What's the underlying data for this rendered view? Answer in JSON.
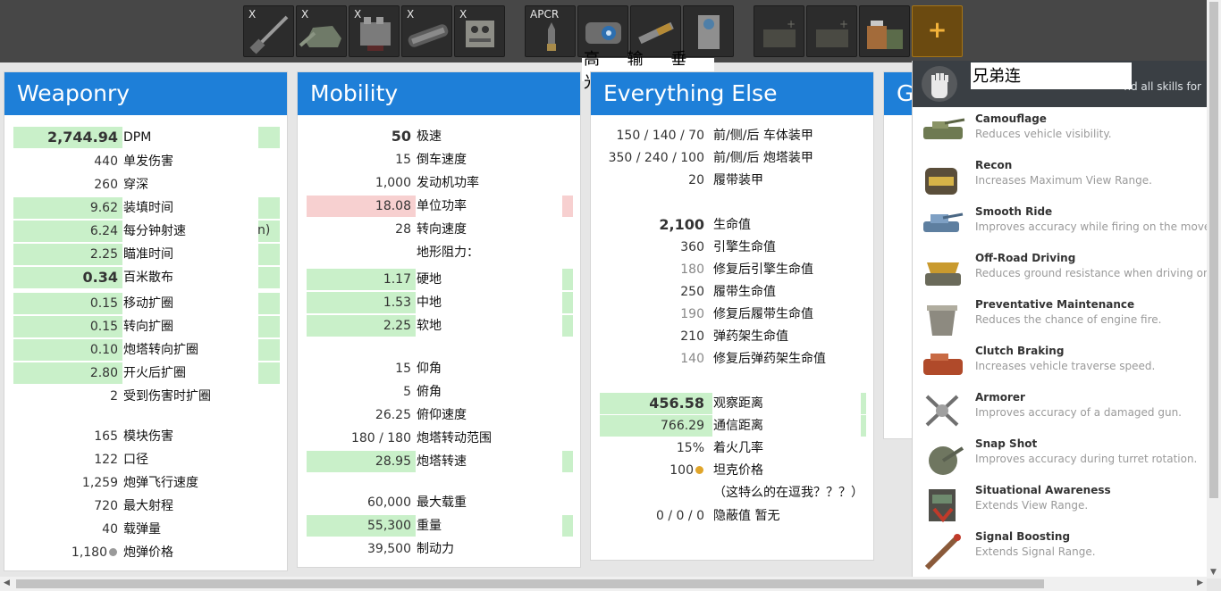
{
  "toolbar": {
    "slots": [
      {
        "tag": "X",
        "icon": "gun-icon"
      },
      {
        "tag": "X",
        "icon": "turret-icon"
      },
      {
        "tag": "X",
        "icon": "engine-icon"
      },
      {
        "tag": "X",
        "icon": "tracks-icon"
      },
      {
        "tag": "X",
        "icon": "radio-icon"
      },
      {
        "tag": "APCR",
        "icon": "apcr-shell-icon"
      },
      {
        "tag": "",
        "icon": "optics-icon"
      },
      {
        "tag": "",
        "icon": "rammer-icon"
      },
      {
        "tag": "",
        "icon": "stabilizer-icon"
      },
      {
        "tag": "",
        "icon": "empty-consumable-icon"
      },
      {
        "tag": "",
        "icon": "empty-consumable-icon"
      },
      {
        "tag": "",
        "icon": "consumables-icon"
      },
      {
        "tag": "+",
        "icon": "add-icon"
      }
    ],
    "equipment_labels": [
      "高光",
      "输弹",
      "垂稳"
    ]
  },
  "weaponry": {
    "title": "Weaponry",
    "rows": [
      {
        "value": "2,744.94",
        "label": "DPM"
      },
      {
        "value": "440",
        "label": "单发伤害"
      },
      {
        "value": "260",
        "label": "穿深"
      },
      {
        "value": "9.62",
        "label": "装填时间"
      },
      {
        "value": "6.24",
        "label": "每分钟射速"
      },
      {
        "value": "2.25",
        "label": "瞄准时间"
      },
      {
        "value": "0.34",
        "label": "百米散布"
      },
      {
        "value": "0.15",
        "label": "移动扩圈"
      },
      {
        "value": "0.15",
        "label": "转向扩圈"
      },
      {
        "value": "0.10",
        "label": "炮塔转向扩圈"
      },
      {
        "value": "2.80",
        "label": "开火后扩圈"
      },
      {
        "value": "2",
        "label": "受到伤害时扩圈"
      },
      {
        "value": "165",
        "label": "模块伤害"
      },
      {
        "value": "122",
        "label": "口径"
      },
      {
        "value": "1,259",
        "label": "炮弹飞行速度"
      },
      {
        "value": "720",
        "label": "最大射程"
      },
      {
        "value": "40",
        "label": "载弹量"
      },
      {
        "value": "1,180",
        "label": "炮弹价格"
      }
    ],
    "partial_text": "n)"
  },
  "mobility": {
    "title": "Mobility",
    "rows": [
      {
        "value": "50",
        "label": "极速"
      },
      {
        "value": "15",
        "label": "倒车速度"
      },
      {
        "value": "1,000",
        "label": "发动机功率"
      },
      {
        "value": "18.08",
        "label": "单位功率"
      },
      {
        "value": "28",
        "label": "转向速度"
      },
      {
        "value": "",
        "label": "地形阻力："
      },
      {
        "value": "1.17",
        "label": "硬地"
      },
      {
        "value": "1.53",
        "label": "中地"
      },
      {
        "value": "2.25",
        "label": "软地"
      },
      {
        "value": "15",
        "label": "仰角"
      },
      {
        "value": "5",
        "label": "俯角"
      },
      {
        "value": "26.25",
        "label": "俯仰速度"
      },
      {
        "value": "180 / 180",
        "label": "炮塔转动范围"
      },
      {
        "value": "28.95",
        "label": "炮塔转速"
      },
      {
        "value": "60,000",
        "label": "最大载重"
      },
      {
        "value": "55,300",
        "label": "重量"
      },
      {
        "value": "39,500",
        "label": "制动力"
      }
    ]
  },
  "everything_else": {
    "title": "Everything Else",
    "rows": [
      {
        "value": "150 / 140 / 70",
        "label": "前/侧/后 车体装甲"
      },
      {
        "value": "350 / 240 / 100",
        "label": "前/侧/后 炮塔装甲"
      },
      {
        "value": "20",
        "label": "履带装甲"
      },
      {
        "value": "2,100",
        "label": "生命值"
      },
      {
        "value": "360",
        "label": "引擎生命值"
      },
      {
        "value": "180",
        "label": "修复后引擎生命值"
      },
      {
        "value": "250",
        "label": "履带生命值"
      },
      {
        "value": "190",
        "label": "修复后履带生命值"
      },
      {
        "value": "210",
        "label": "弹药架生命值"
      },
      {
        "value": "140",
        "label": "修复后弹药架生命值"
      },
      {
        "value": "456.58",
        "label": "观察距离"
      },
      {
        "value": "766.29",
        "label": "通信距离"
      },
      {
        "value": "15%",
        "label": "着火几率"
      },
      {
        "value": "100",
        "label": "坦克价格"
      },
      {
        "value": "",
        "label": "（这特么的在逗我？？？）"
      },
      {
        "value": "0 / 0 / 0",
        "label": "隐蔽值 暂无"
      }
    ]
  },
  "fourth_panel": {
    "title_fragment": "G"
  },
  "skills_popup": {
    "crew_label": "兄弟连",
    "header_hint": "nd all skills for",
    "skills": [
      {
        "name": "Camouflage",
        "desc": "Reduces vehicle visibility."
      },
      {
        "name": "Recon",
        "desc": "Increases Maximum View Range."
      },
      {
        "name": "Smooth Ride",
        "desc": "Improves accuracy while firing on the move."
      },
      {
        "name": "Off-Road Driving",
        "desc": "Reduces ground resistance when driving on sc"
      },
      {
        "name": "Preventative Maintenance",
        "desc": "Reduces the chance of engine fire."
      },
      {
        "name": "Clutch Braking",
        "desc": "Increases vehicle traverse speed."
      },
      {
        "name": "Armorer",
        "desc": "Improves accuracy of a damaged gun."
      },
      {
        "name": "Snap Shot",
        "desc": "Improves accuracy during turret rotation."
      },
      {
        "name": "Situational Awareness",
        "desc": "Extends View Range."
      },
      {
        "name": "Signal Boosting",
        "desc": "Extends Signal Range."
      }
    ]
  },
  "colors": {
    "panel_header": "#1e7fd8",
    "highlight_green": "#c9f0c9",
    "highlight_red": "#f7d0d0",
    "toolbar_bg": "#474747",
    "add_slot": "#6b4a10"
  }
}
